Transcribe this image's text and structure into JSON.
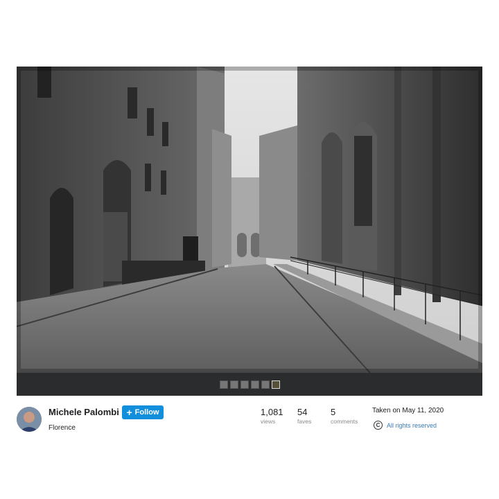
{
  "photo": {
    "alt_description": "",
    "filmstrip_count": 6,
    "active_thumb_index": 5
  },
  "owner": {
    "name": "Michele Palombi",
    "location": "Florence",
    "follow_label": "Follow",
    "follow_icon": "plus-icon"
  },
  "stats": {
    "views_count": "1,081",
    "views_label": "views",
    "faves_count": "54",
    "faves_label": "faves",
    "comments_count": "5",
    "comments_label": "comments"
  },
  "info": {
    "taken": "Taken on May 11, 2020",
    "rights": "All rights reserved",
    "rights_icon": "copyright-icon"
  },
  "colors": {
    "follow_button": "#128fdc",
    "rights_link": "#3a7bb5",
    "viewer_background": "#1f2022"
  }
}
